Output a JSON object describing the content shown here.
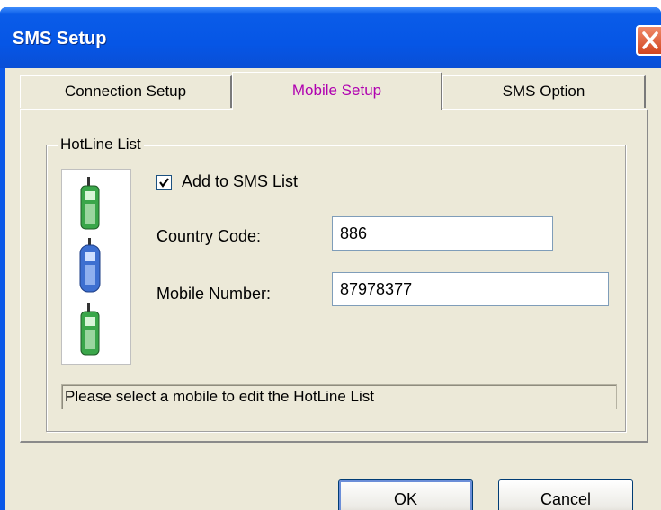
{
  "window": {
    "title": "SMS Setup"
  },
  "tabs": [
    {
      "label": "Connection Setup",
      "active": false
    },
    {
      "label": "Mobile Setup",
      "active": true
    },
    {
      "label": "SMS Option",
      "active": false
    }
  ],
  "hotline": {
    "group_title": "HotLine List",
    "add_to_sms_list": {
      "label": "Add to SMS List",
      "checked": true
    },
    "country_code": {
      "label": "Country Code:",
      "value": "886"
    },
    "mobile_number": {
      "label": "Mobile Number:",
      "value": "87978377"
    },
    "status_text": "Please select a mobile to edit the HotLine List",
    "phones": [
      {
        "name": "green-phone",
        "color": "#3aa64a"
      },
      {
        "name": "blue-phone",
        "color": "#3d6fd0"
      },
      {
        "name": "green-phone",
        "color": "#3aa64a"
      }
    ]
  },
  "buttons": {
    "ok": "OK",
    "cancel": "Cancel"
  },
  "colors": {
    "titlebar": "#0a58e8",
    "active_tab_text": "#b000b0",
    "close": "#d2451f"
  }
}
